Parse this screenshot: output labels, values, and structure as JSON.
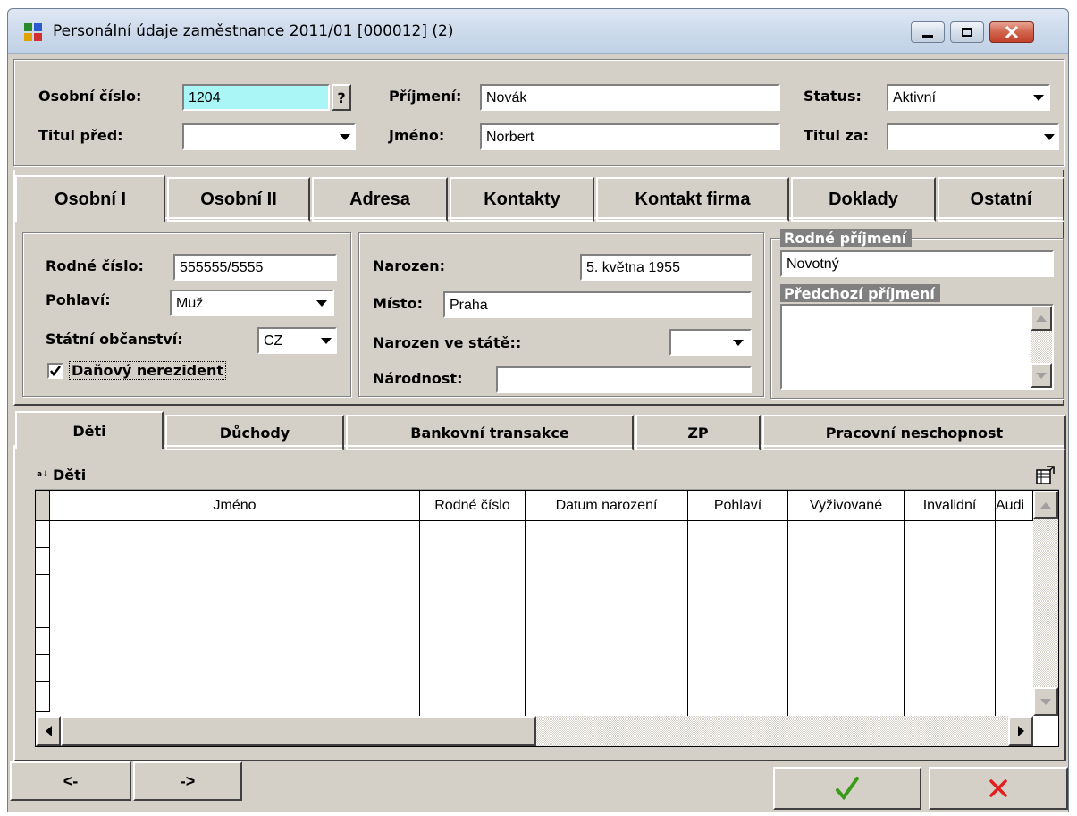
{
  "window": {
    "title": "Personální údaje zaměstnance 2011/01 [000012] (2)"
  },
  "header": {
    "osobni_cislo_label": "Osobní číslo:",
    "osobni_cislo_value": "1204",
    "help_label": "?",
    "prijmeni_label": "Příjmení:",
    "prijmeni_value": "Novák",
    "status_label": "Status:",
    "status_value": "Aktivní",
    "titul_pred_label": "Titul před:",
    "titul_pred_value": "",
    "jmeno_label": "Jméno:",
    "jmeno_value": "Norbert",
    "titul_za_label": "Titul za:",
    "titul_za_value": ""
  },
  "tabs": [
    {
      "label": "Osobní I",
      "active": true
    },
    {
      "label": "Osobní II"
    },
    {
      "label": "Adresa"
    },
    {
      "label": "Kontakty"
    },
    {
      "label": "Kontakt firma"
    },
    {
      "label": "Doklady"
    },
    {
      "label": "Ostatní"
    }
  ],
  "osobni1": {
    "rodne_cislo_label": "Rodné číslo:",
    "rodne_cislo_value": "555555/5555",
    "pohlavi_label": "Pohlaví:",
    "pohlavi_value": "Muž",
    "obcanstvi_label": "Státní občanství:",
    "obcanstvi_value": "CZ",
    "danovy_nerezident_label": "Daňový nerezident",
    "danovy_nerezident_checked": true,
    "narozen_label": "Narozen:",
    "narozen_value": "5. května 1955",
    "misto_label": "Místo:",
    "misto_value": "Praha",
    "narozen_ve_state_label": "Narozen ve státě::",
    "narozen_ve_state_value": "",
    "narodnost_label": "Národnost:",
    "narodnost_value": "",
    "rodne_prijmeni_label": "Rodné příjmení",
    "rodne_prijmeni_value": "Novotný",
    "predchozi_prijmeni_label": "Předchozí příjmení",
    "predchozi_prijmeni_value": ""
  },
  "subtabs": [
    {
      "label": "Děti",
      "active": true
    },
    {
      "label": "Důchody"
    },
    {
      "label": "Bankovní transakce"
    },
    {
      "label": "ZP"
    },
    {
      "label": "Pracovní neschopnost"
    }
  ],
  "grid": {
    "caption": "Děti",
    "columns": [
      "Jméno",
      "Rodné číslo",
      "Datum narození",
      "Pohlaví",
      "Vyživované",
      "Invalidní",
      "Audi"
    ],
    "rows": []
  },
  "footer": {
    "prev_label": "<-",
    "next_label": "->"
  },
  "colors": {
    "face": "#d4d0c8",
    "highlight_field": "#aaf5f5",
    "ok_green": "#3a9a1a",
    "cancel_red": "#e02020"
  }
}
